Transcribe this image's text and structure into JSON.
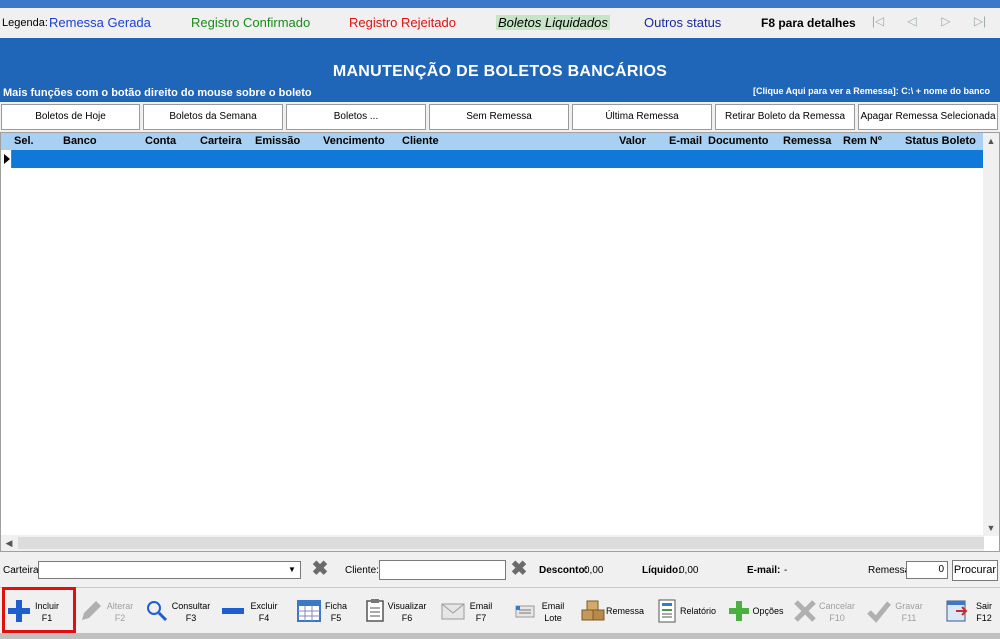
{
  "legend": {
    "label": "Legenda:",
    "remessa_gerada": "Remessa Gerada",
    "registro_confirmado": "Registro Confirmado",
    "registro_rejeitado": "Registro Rejeitado",
    "boletos_liquidados": "Boletos Liquidados",
    "outros_status": "Outros status",
    "f8_hint": "F8 para detalhes",
    "colors": {
      "gerada": "#1a3fd8",
      "confirmado": "#1c8a1c",
      "rejeitado": "#e01010",
      "liquidados_bg": "#c6e5c6",
      "outros": "#1b2a9a"
    }
  },
  "navigation": {
    "first": "first-record-icon",
    "prev": "prev-record-icon",
    "next": "next-record-icon",
    "last": "last-record-icon"
  },
  "banner": {
    "title": "MANUTENÇÃO DE BOLETOS BANCÁRIOS",
    "subtitle": "Mais funções com o botão direito do mouse sobre o boleto",
    "hint": "[Clique Aqui para ver a Remessa]: C:\\ + nome do banco",
    "color": "#1f65b8"
  },
  "filters": [
    "Boletos de Hoje",
    "Boletos da Semana",
    "Boletos ...",
    "Sem Remessa",
    "Última Remessa",
    "Retirar Boleto da Remessa",
    "Apagar Remessa Selecionada"
  ],
  "grid": {
    "columns": [
      "Sel.",
      "Banco",
      "Conta",
      "Carteira",
      "Emissão",
      "Vencimento",
      "Cliente",
      "Valor",
      "E-mail",
      "Documento",
      "Remessa",
      "Rem Nº",
      "Status Boleto"
    ],
    "header_color": "#a8d0f2",
    "selected_row_color": "#0f78d8"
  },
  "search": {
    "carteira_label": "Carteira",
    "cliente_label": "Cliente:",
    "desconto_label": "Desconto:",
    "desconto_value": "0,00",
    "liquido_label": "Líquido:",
    "liquido_value": "0,00",
    "email_label": "E-mail:",
    "email_value": "-",
    "remessa_label": "Remessa",
    "remessa_value": "0",
    "procurar": "Procurar"
  },
  "toolbar": [
    {
      "label1": "Incluir",
      "label2": "F1",
      "icon": "plus-icon"
    },
    {
      "label1": "Alterar",
      "label2": "F2",
      "icon": "pencil-icon"
    },
    {
      "label1": "Consultar",
      "label2": "F3",
      "icon": "magnifier-icon"
    },
    {
      "label1": "Excluir",
      "label2": "F4",
      "icon": "minus-icon"
    },
    {
      "label1": "Ficha",
      "label2": "F5",
      "icon": "calendar-icon"
    },
    {
      "label1": "Visualizar",
      "label2": "F6",
      "icon": "clipboard-icon"
    },
    {
      "label1": "Email",
      "label2": "F7",
      "icon": "envelope-icon"
    },
    {
      "label1": "Email",
      "label2": "Lote",
      "icon": "email-batch-icon"
    },
    {
      "label1": "Remessa",
      "label2": "",
      "icon": "boxes-icon"
    },
    {
      "label1": "Relatório",
      "label2": "",
      "icon": "report-icon"
    },
    {
      "label1": "Opções",
      "label2": "",
      "icon": "green-plus-icon"
    },
    {
      "label1": "Cancelar",
      "label2": "F10",
      "icon": "cancel-x-icon"
    },
    {
      "label1": "Gravar",
      "label2": "F11",
      "icon": "checkmark-icon"
    },
    {
      "label1": "Sair",
      "label2": "F12",
      "icon": "exit-icon"
    }
  ]
}
